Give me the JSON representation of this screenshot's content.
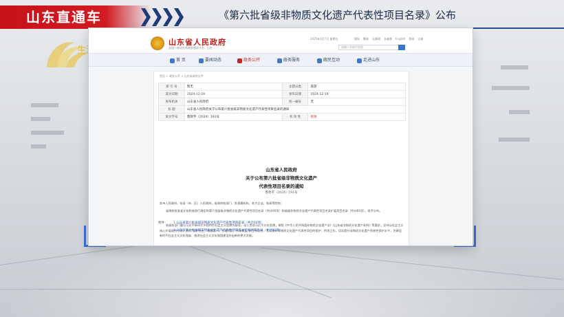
{
  "broadcast": {
    "logo": "山东直通车",
    "headline": "《第六批省级非物质文化遗产代表性项目名录》公布",
    "watermark": "生活"
  },
  "colors": {
    "brand_red": "#d21b22",
    "headline_navy": "#1d2b4a",
    "accent_blue": "#3a6fd8",
    "gov_red": "#b51f1f",
    "link_blue": "#2f5fb3"
  },
  "site": {
    "title": "山东省人民政府",
    "subtitle": "全国一体化在线政务服务平台 · 山东",
    "date": "2025年3月7日 星期五",
    "top_links": [
      "国际",
      "繁体",
      "无障碍",
      "长者版",
      "English",
      "登录",
      "注册"
    ],
    "search_placeholder": "请输入关键字搜索"
  },
  "nav": [
    {
      "label": "首 页",
      "icon": "home-icon",
      "active": false
    },
    {
      "label": "要闻动态",
      "icon": "news-icon",
      "active": false
    },
    {
      "label": "政务公开",
      "icon": "document-icon",
      "active": true
    },
    {
      "label": "政务服务",
      "icon": "service-icon",
      "active": false
    },
    {
      "label": "政民互动",
      "icon": "chat-icon",
      "active": false
    },
    {
      "label": "走进山东",
      "icon": "landmark-icon",
      "active": false
    }
  ],
  "breadcrumb": "首页 > 政务公开 > 山东省政府文件",
  "meta": {
    "index_label": "索 引 号",
    "index_value": "暂无",
    "topic_label": "主题分类",
    "topic_value": "旅游",
    "created_label": "成文日期",
    "created_value": "2024-12-19",
    "published_label": "发布日期",
    "published_value": "2024-12-19",
    "issuer_label": "发布机关",
    "issuer_value": "山东省人民政府",
    "series_label": "统一编号",
    "series_value": "无",
    "title_label": "标 题",
    "title_value": "山东省人民政府关于公布第六批省级非物质文化遗产代表性项目名录的通知",
    "docno_label": "发文字号",
    "docno_value": "鲁政字〔2024〕191号",
    "validity_label": "有 效 性",
    "validity_value": "有效"
  },
  "doc": {
    "title_line1": "山东省人民政府",
    "title_line2": "关于公布第六批省级非物质文化遗产",
    "title_line3": "代表性项目名录的通知",
    "number": "鲁政字〔2024〕191号",
    "salutation": "各市人民政府，各县（市、区）人民政府，省政府各部门、各直属机构，各大企业，各高等院校：",
    "para1": "省政府批准省文化和旅游厅确定的第六批省级非物质文化遗产代表性项目名录（共计60项）和省级非物质文化遗产代表性项目名录扩展项目名录（共计81项），现予公布。",
    "para2": "各级各部门要以习近平新时代中国特色社会主义思想为指导，深入贯彻习近平文化思想，按照《中华人民共和国非物质文化遗产法》《山东省非物质文化遗产条例》等要求，坚持以社会主义核心价值观为引领，贯彻“保护为主、抢救第一、合理利用、传承发展”的工作方针，扎实做好非物质文化遗产代表性项目的保护、传承工作，切实提升非物质文化遗产系统性保护水平，为建设新时代社会主义文化强省、推进社会主义文化强国建设作出新的更大贡献。",
    "attachments_label": "附件：",
    "attachment1": "1.山东省第六批省级非物质文化遗产代表性项目名录（共计60项）",
    "attachment2": "2.山东省第六批省级非物质文化遗产代表性项目名录扩展项目名录（共计81项）"
  }
}
